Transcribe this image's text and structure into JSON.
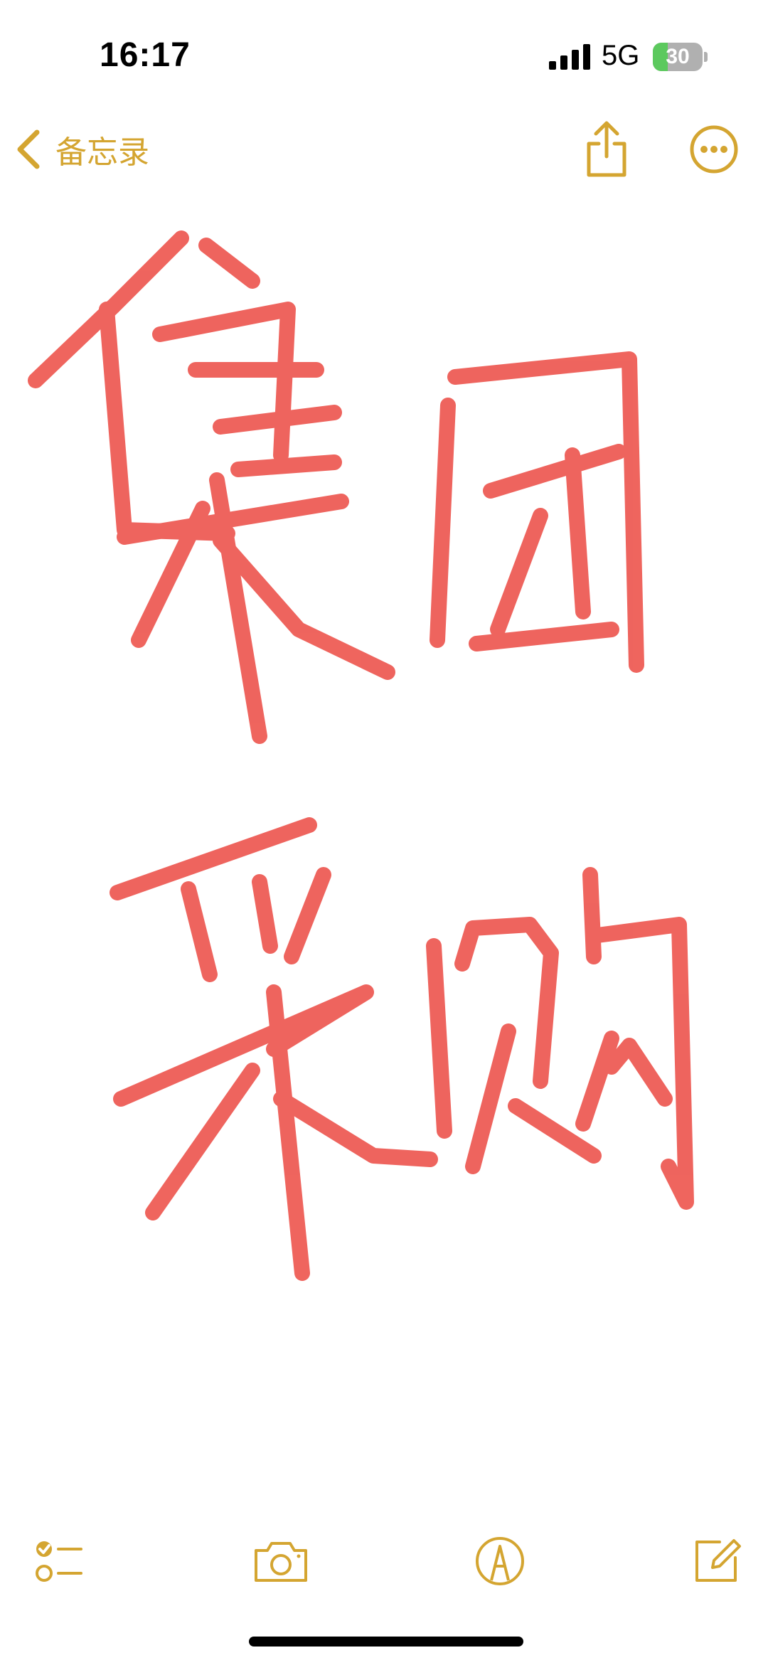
{
  "status_bar": {
    "time": "16:17",
    "network": "5G",
    "battery_percent": "30",
    "battery_level": 0.3
  },
  "nav": {
    "back_label": "备忘录",
    "back_icon": "chevron-left-icon",
    "share_icon": "share-icon",
    "more_icon": "ellipsis-circle-icon"
  },
  "note": {
    "content_type": "handwritten-drawing",
    "ink_color": "#ec4a42"
  },
  "toolbar": {
    "items": [
      {
        "icon": "checklist-icon"
      },
      {
        "icon": "camera-icon"
      },
      {
        "icon": "markup-pen-icon"
      },
      {
        "icon": "compose-icon"
      }
    ]
  },
  "colors": {
    "accent": "#d4a531",
    "ink": "#ec4a42",
    "background": "#ffffff"
  }
}
